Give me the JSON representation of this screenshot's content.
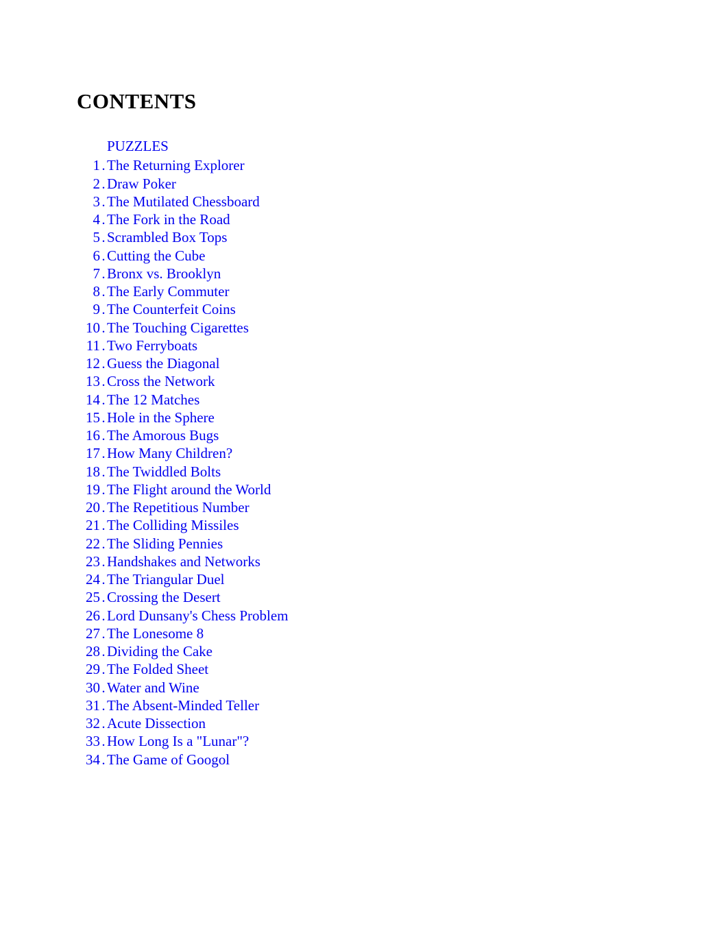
{
  "title": "CONTENTS",
  "section_label": "PUZZLES",
  "entries": [
    {
      "num": "1",
      "title": "The Returning Explorer"
    },
    {
      "num": "2",
      "title": "Draw Poker"
    },
    {
      "num": "3",
      "title": "The Mutilated Chessboard"
    },
    {
      "num": "4",
      "title": "The Fork in the Road"
    },
    {
      "num": "5",
      "title": "Scrambled Box Tops"
    },
    {
      "num": "6",
      "title": "Cutting the Cube"
    },
    {
      "num": "7",
      "title": "Bronx vs. Brooklyn"
    },
    {
      "num": "8",
      "title": "The Early Commuter"
    },
    {
      "num": "9",
      "title": "The Counterfeit Coins"
    },
    {
      "num": "10",
      "title": "The Touching Cigarettes"
    },
    {
      "num": "11",
      "title": "Two Ferryboats"
    },
    {
      "num": "12",
      "title": "Guess the Diagonal"
    },
    {
      "num": "13",
      "title": "Cross the Network"
    },
    {
      "num": "14",
      "title": "The 12 Matches"
    },
    {
      "num": "15",
      "title": "Hole in the Sphere"
    },
    {
      "num": "16",
      "title": "The Amorous Bugs"
    },
    {
      "num": "17",
      "title": "How Many Children?"
    },
    {
      "num": "18",
      "title": "The Twiddled Bolts"
    },
    {
      "num": "19",
      "title": "The Flight around the World"
    },
    {
      "num": "20",
      "title": "The Repetitious Number"
    },
    {
      "num": "21",
      "title": "The Colliding Missiles"
    },
    {
      "num": "22",
      "title": "The Sliding Pennies"
    },
    {
      "num": "23",
      "title": "Handshakes and Networks"
    },
    {
      "num": "24",
      "title": "The Triangular Duel"
    },
    {
      "num": "25",
      "title": "Crossing the Desert"
    },
    {
      "num": "26",
      "title": "Lord Dunsany's Chess Problem"
    },
    {
      "num": "27",
      "title": "The Lonesome 8"
    },
    {
      "num": "28",
      "title": "Dividing the Cake"
    },
    {
      "num": "29",
      "title": "The Folded Sheet"
    },
    {
      "num": "30",
      "title": "Water and Wine"
    },
    {
      "num": "31",
      "title": "The Absent-Minded Teller"
    },
    {
      "num": "32",
      "title": "Acute Dissection"
    },
    {
      "num": "33",
      "title": "How Long Is a \"Lunar\"?"
    },
    {
      "num": "34",
      "title": "The Game of Googol"
    }
  ]
}
